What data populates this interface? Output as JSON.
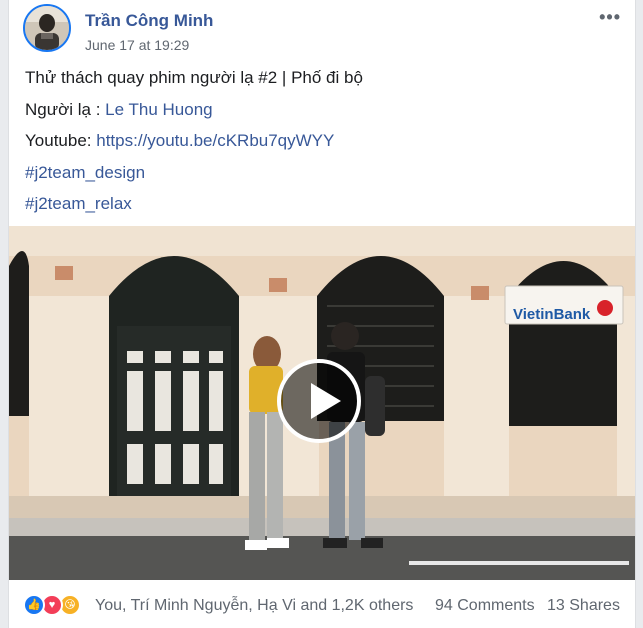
{
  "post": {
    "author": "Trần Công Minh",
    "timestamp": "June 17 at 19:29",
    "more_icon": "•••",
    "lines": {
      "title": "Thử thách quay phim người lạ #2 | Phố đi bộ",
      "stranger_label": "Người lạ : ",
      "stranger_name": "Le Thu Huong",
      "youtube_label": "Youtube: ",
      "youtube_link": "https://youtu.be/cKRbu7qyWYY",
      "hashtag1": "#j2team_design",
      "hashtag2": "#j2team_relax"
    },
    "video": {
      "icon": "play-icon",
      "sign_text": "VietinBank"
    },
    "footer": {
      "reactions": [
        "like-icon",
        "love-icon",
        "haha-icon"
      ],
      "reaction_names": "You, Trí Minh Nguyễn, Hạ Vi and 1,2K others",
      "comments": "94 Comments",
      "shares": "13 Shares"
    }
  },
  "colors": {
    "link": "#385898",
    "like": "#1877f2",
    "love": "#f33e58",
    "haha": "#f7b125"
  }
}
